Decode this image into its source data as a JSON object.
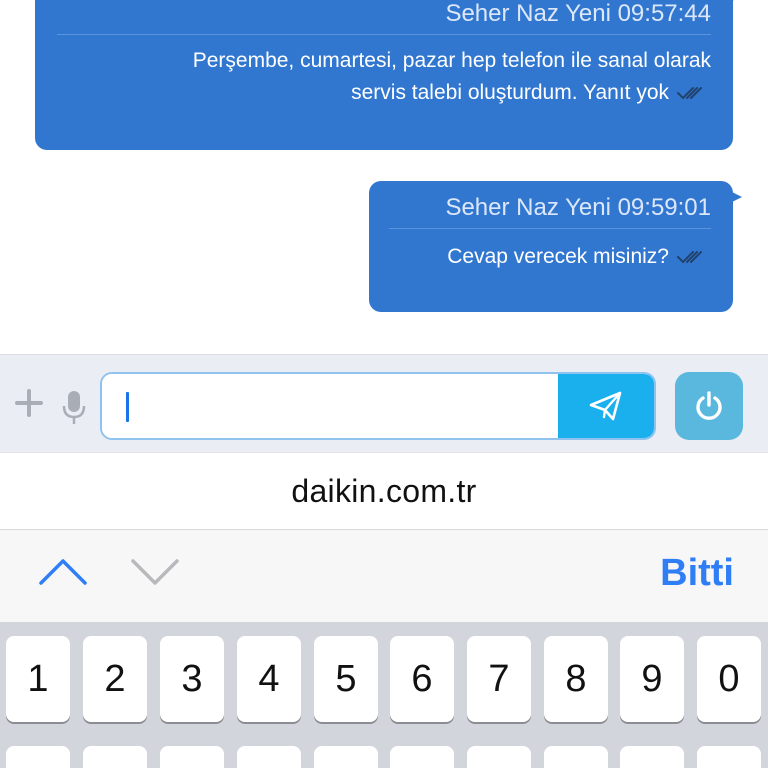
{
  "messages": [
    {
      "sender": "Seher Naz Yeni",
      "time": "09:57:44",
      "lines": [
        "Perşembe, cumartesi, pazar hep telefon ile sanal olarak",
        "servis talebi oluşturdum. Yanıt yok"
      ]
    },
    {
      "sender": "Seher Naz Yeni",
      "time": "09:59:01",
      "lines": [
        "Cevap verecek misiniz?"
      ]
    }
  ],
  "composer": {
    "value": "",
    "icons": [
      "plus-icon",
      "microphone-icon",
      "paper-plane-icon",
      "power-icon"
    ]
  },
  "browser": {
    "domain": "daikin.com.tr"
  },
  "form_toolbar": {
    "done_label": "Bitti"
  },
  "keyboard": {
    "number_row": [
      "1",
      "2",
      "3",
      "4",
      "5",
      "6",
      "7",
      "8",
      "9",
      "0"
    ]
  },
  "colors": {
    "bubble": "#3277cf",
    "send_button": "#1ab0ee",
    "power_button": "#5ab8de",
    "done_text": "#2f7ef6",
    "chevron_up": "#2f7ef6",
    "chevron_down": "#b8b8bd"
  }
}
